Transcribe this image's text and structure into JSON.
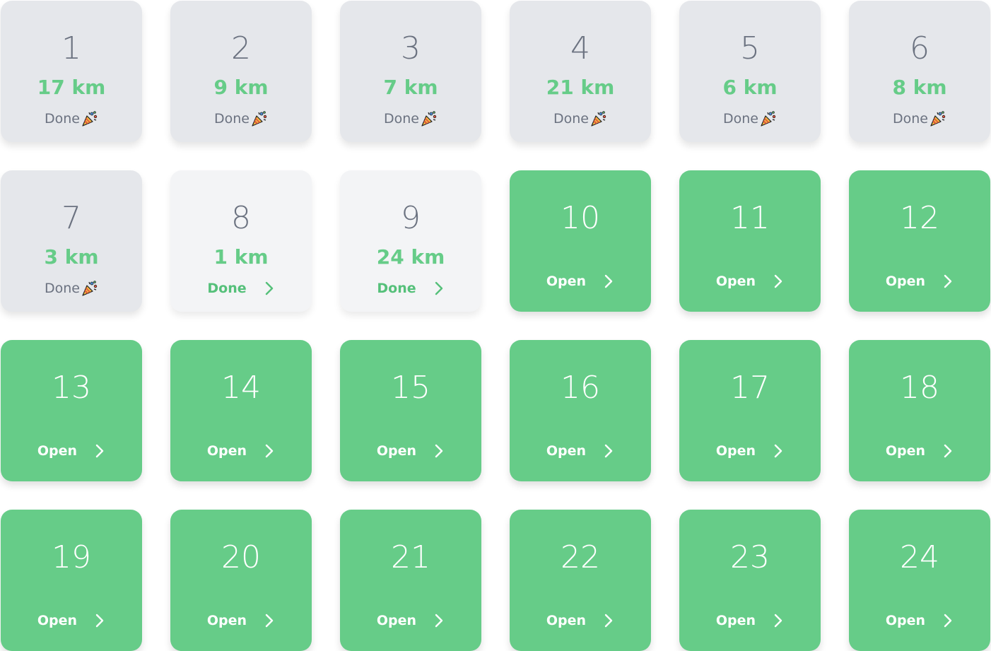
{
  "colors": {
    "accent_green": "#66cc88",
    "done_bg": "#e5e7eb",
    "done_link_bg": "#f3f4f6",
    "text_gray": "#6b7280"
  },
  "icons": {
    "celebration": "party-popper-icon",
    "arrow": "chevron-right-icon"
  },
  "tiles": [
    {
      "day": "1",
      "km": "17 km",
      "status": "Done",
      "state": "done"
    },
    {
      "day": "2",
      "km": "9 km",
      "status": "Done",
      "state": "done"
    },
    {
      "day": "3",
      "km": "7 km",
      "status": "Done",
      "state": "done"
    },
    {
      "day": "4",
      "km": "21 km",
      "status": "Done",
      "state": "done"
    },
    {
      "day": "5",
      "km": "6 km",
      "status": "Done",
      "state": "done"
    },
    {
      "day": "6",
      "km": "8 km",
      "status": "Done",
      "state": "done"
    },
    {
      "day": "7",
      "km": "3 km",
      "status": "Done",
      "state": "done"
    },
    {
      "day": "8",
      "km": "1 km",
      "status": "Done",
      "state": "done-link"
    },
    {
      "day": "9",
      "km": "24 km",
      "status": "Done",
      "state": "done-link"
    },
    {
      "day": "10",
      "status": "Open",
      "state": "open"
    },
    {
      "day": "11",
      "status": "Open",
      "state": "open"
    },
    {
      "day": "12",
      "status": "Open",
      "state": "open"
    },
    {
      "day": "13",
      "status": "Open",
      "state": "open"
    },
    {
      "day": "14",
      "status": "Open",
      "state": "open"
    },
    {
      "day": "15",
      "status": "Open",
      "state": "open"
    },
    {
      "day": "16",
      "status": "Open",
      "state": "open"
    },
    {
      "day": "17",
      "status": "Open",
      "state": "open"
    },
    {
      "day": "18",
      "status": "Open",
      "state": "open"
    },
    {
      "day": "19",
      "status": "Open",
      "state": "open"
    },
    {
      "day": "20",
      "status": "Open",
      "state": "open"
    },
    {
      "day": "21",
      "status": "Open",
      "state": "open"
    },
    {
      "day": "22",
      "status": "Open",
      "state": "open"
    },
    {
      "day": "23",
      "status": "Open",
      "state": "open"
    },
    {
      "day": "24",
      "status": "Open",
      "state": "open"
    }
  ]
}
